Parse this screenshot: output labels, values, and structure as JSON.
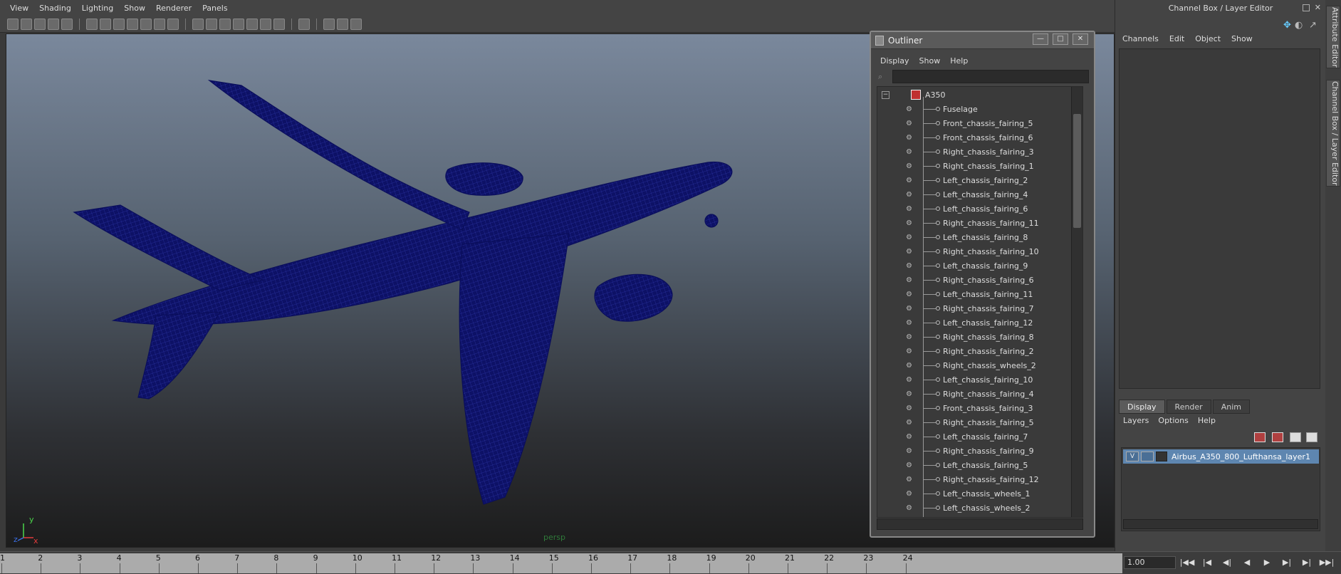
{
  "viewport": {
    "menu": [
      "View",
      "Shading",
      "Lighting",
      "Show",
      "Renderer",
      "Panels"
    ],
    "camera_label": "persp",
    "axis_labels": {
      "x": "x",
      "y": "y",
      "z": "z"
    },
    "wire_color": "#0e1370"
  },
  "outliner": {
    "title": "Outliner",
    "menu": [
      "Display",
      "Show",
      "Help"
    ],
    "root": "A350",
    "items": [
      "Fuselage",
      "Front_chassis_fairing_5",
      "Front_chassis_fairing_6",
      "Right_chassis_fairing_3",
      "Right_chassis_fairing_1",
      "Left_chassis_fairing_2",
      "Left_chassis_fairing_4",
      "Left_chassis_fairing_6",
      "Right_chassis_fairing_11",
      "Left_chassis_fairing_8",
      "Right_chassis_fairing_10",
      "Left_chassis_fairing_9",
      "Right_chassis_fairing_6",
      "Left_chassis_fairing_11",
      "Right_chassis_fairing_7",
      "Left_chassis_fairing_12",
      "Right_chassis_fairing_8",
      "Right_chassis_fairing_2",
      "Right_chassis_wheels_2",
      "Left_chassis_fairing_10",
      "Right_chassis_fairing_4",
      "Front_chassis_fairing_3",
      "Right_chassis_fairing_5",
      "Left_chassis_fairing_7",
      "Right_chassis_fairing_9",
      "Left_chassis_fairing_5",
      "Right_chassis_fairing_12",
      "Left_chassis_wheels_1",
      "Left_chassis_wheels_2"
    ]
  },
  "channel_box": {
    "title": "Channel Box / Layer Editor",
    "menu": [
      "Channels",
      "Edit",
      "Object",
      "Show"
    ]
  },
  "layer_editor": {
    "tabs": [
      "Display",
      "Render",
      "Anim"
    ],
    "menu": [
      "Layers",
      "Options",
      "Help"
    ],
    "layer_visible_flag": "V",
    "layer_name": "Airbus_A350_800_Lufthansa_layer1"
  },
  "side_tabs": [
    "Attribute Editor",
    "Channel Box / Layer Editor"
  ],
  "timeline": {
    "frames": [
      "1",
      "2",
      "3",
      "4",
      "5",
      "6",
      "7",
      "8",
      "9",
      "10",
      "11",
      "12",
      "13",
      "14",
      "15",
      "16",
      "17",
      "18",
      "19",
      "20",
      "21",
      "22",
      "23",
      "24"
    ],
    "current_frame": "1.00"
  }
}
